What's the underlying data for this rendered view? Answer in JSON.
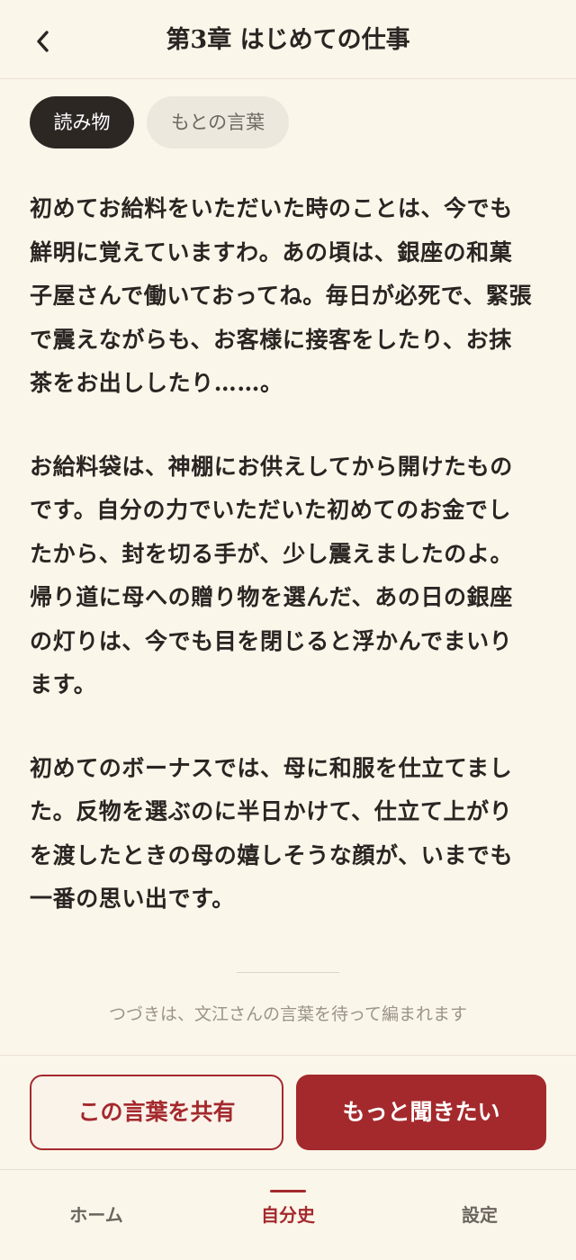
{
  "header": {
    "title": "第3章 はじめての仕事"
  },
  "tabs": [
    {
      "label": "読み物",
      "active": true
    },
    {
      "label": "もとの言葉",
      "active": false
    }
  ],
  "story": {
    "paragraphs": [
      "初めてお給料をいただいた時のことは、今でも鮮明に覚えていますわ。あの頃は、銀座の和菓子屋さんで働いておってね。毎日が必死で、緊張で震えながらも、お客様に接客をしたり、お抹茶をお出ししたり……。",
      "お給料袋は、神棚にお供えしてから開けたものです。自分の力でいただいた初めてのお金でしたから、封を切る手が、少し震えましたのよ。帰り道に母への贈り物を選んだ、あの日の銀座の灯りは、今でも目を閉じると浮かんでまいります。",
      "初めてのボーナスでは、母に和服を仕立てました。反物を選ぶのに半日かけて、仕立て上がりを渡したときの母の嬉しそうな顔が、いまでも一番の思い出です。"
    ],
    "continuation_note": "つづきは、文江さんの言葉を待って編まれます"
  },
  "actions": {
    "share_label": "この言葉を共有",
    "more_label": "もっと聞きたい"
  },
  "nav": {
    "items": [
      {
        "label": "ホーム",
        "active": false
      },
      {
        "label": "自分史",
        "active": true
      },
      {
        "label": "設定",
        "active": false
      }
    ]
  },
  "colors": {
    "background": "#FBF6EA",
    "accent": "#A4292D",
    "text": "#2A2522",
    "active_tab": "#2D2724",
    "inactive_tab": "#EDE8DE"
  }
}
